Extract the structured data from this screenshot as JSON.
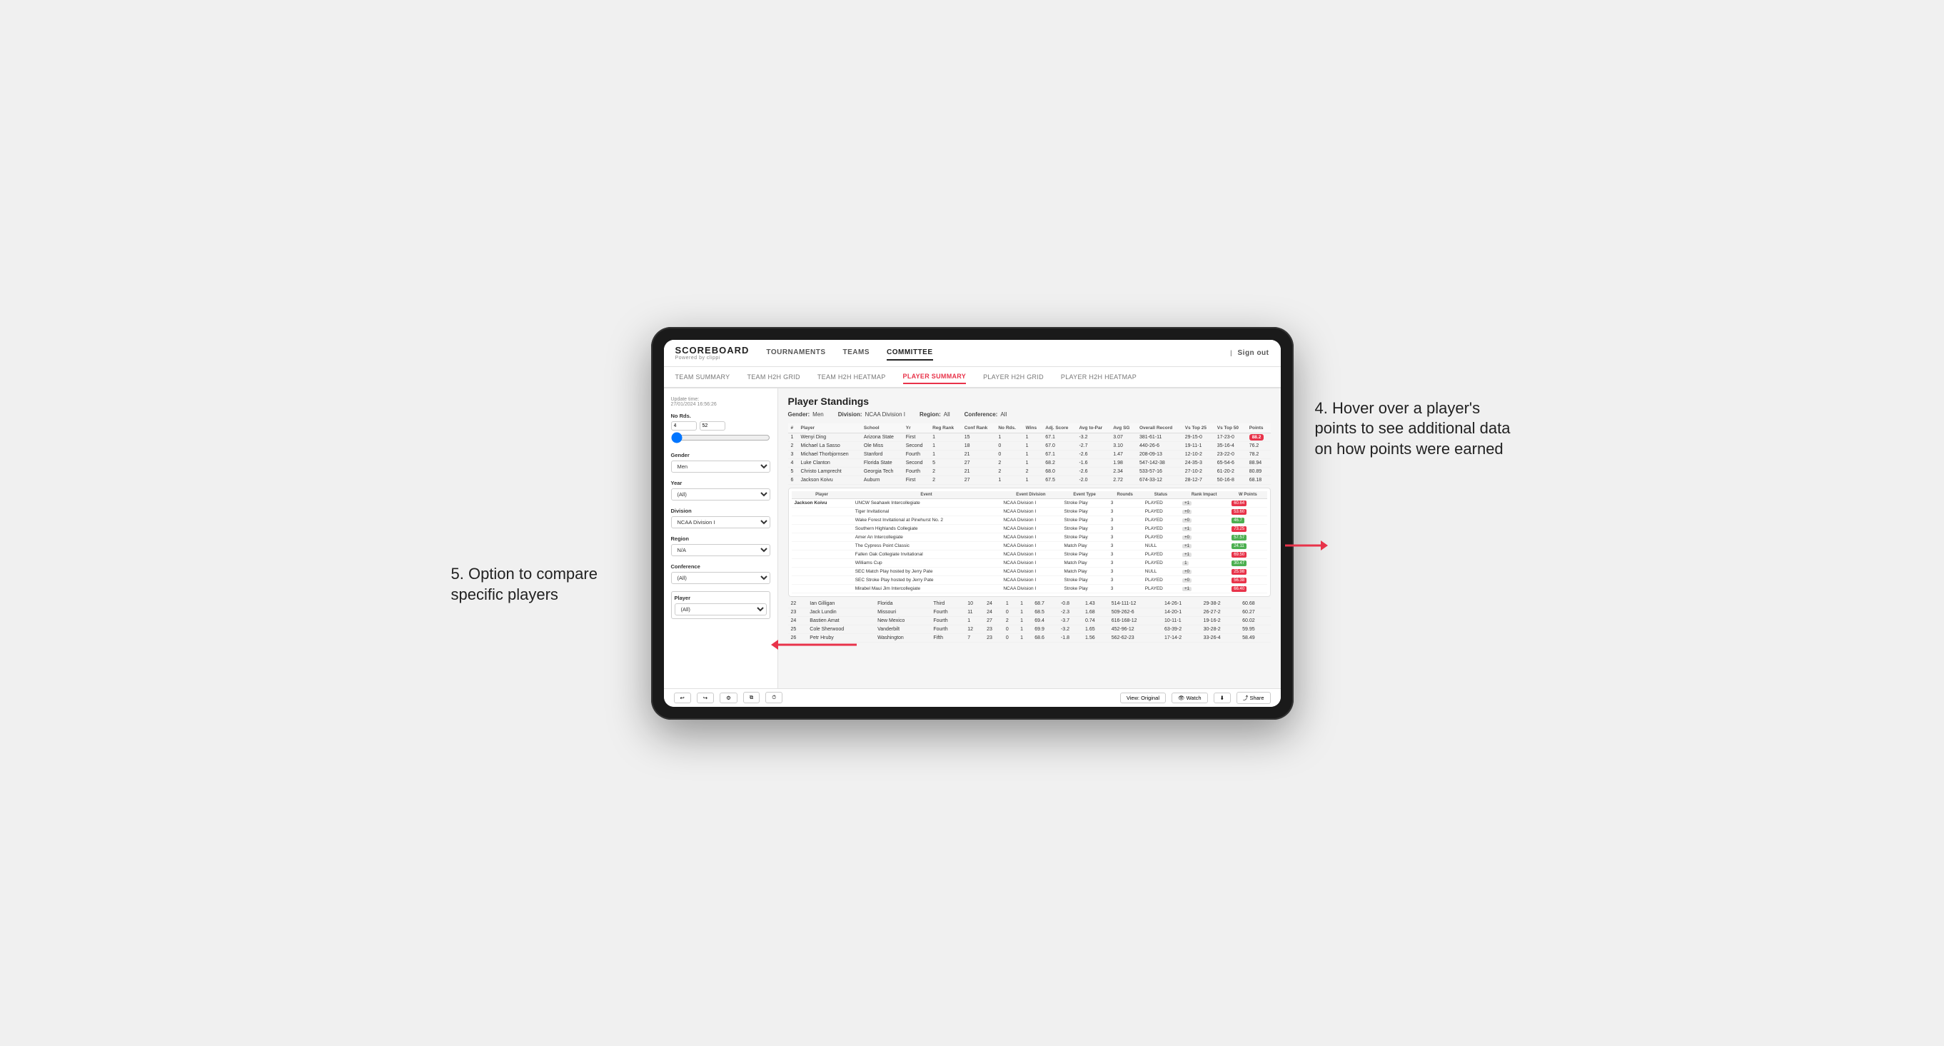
{
  "outer": {
    "annotation_right": "4. Hover over a player's points to see additional data on how points were earned",
    "annotation_left": "5. Option to compare specific players"
  },
  "header": {
    "logo": "SCOREBOARD",
    "logo_sub": "Powered by clippi",
    "nav_items": [
      "TOURNAMENTS",
      "TEAMS",
      "COMMITTEE"
    ],
    "active_nav": "COMMITTEE",
    "sign_out": "Sign out"
  },
  "sub_nav": {
    "items": [
      "TEAM SUMMARY",
      "TEAM H2H GRID",
      "TEAM H2H HEATMAP",
      "PLAYER SUMMARY",
      "PLAYER H2H GRID",
      "PLAYER H2H HEATMAP"
    ],
    "active": "PLAYER SUMMARY"
  },
  "sidebar": {
    "update_label": "Update time:",
    "update_time": "27/01/2024 16:56:26",
    "no_rds_label": "No Rds.",
    "no_rds_min": "4",
    "no_rds_max": "52",
    "gender_label": "Gender",
    "gender_value": "Men",
    "year_label": "Year",
    "year_value": "(All)",
    "division_label": "Division",
    "division_value": "NCAA Division I",
    "region_label": "Region",
    "region_value": "N/A",
    "conference_label": "Conference",
    "conference_value": "(All)",
    "player_label": "Player",
    "player_value": "(All)"
  },
  "content": {
    "title": "Player Standings",
    "gender_label": "Gender:",
    "gender_value": "Men",
    "division_label": "Division:",
    "division_value": "NCAA Division I",
    "region_label": "Region:",
    "region_value": "All",
    "conference_label": "Conference:",
    "conference_value": "All",
    "table_headers": [
      "#",
      "Player",
      "School",
      "Yr",
      "Reg Rank",
      "Conf Rank",
      "No Rds.",
      "Wins",
      "Adj. Score",
      "Avg to-Par",
      "Avg SG",
      "Overall Record",
      "Vs Top 25",
      "Vs Top 50",
      "Points"
    ],
    "players": [
      {
        "num": "1",
        "name": "Wenyi Ding",
        "school": "Arizona State",
        "yr": "First",
        "reg_rank": "1",
        "conf_rank": "15",
        "no_rds": "1",
        "wins": "1",
        "adj_score": "67.1",
        "to_par": "-3.2",
        "avg_sg": "3.07",
        "record": "381-61-11",
        "vs25": "29-15-0",
        "vs50": "17-23-0",
        "points": "88.2",
        "points_color": "red"
      },
      {
        "num": "2",
        "name": "Michael La Sasso",
        "school": "Ole Miss",
        "yr": "Second",
        "reg_rank": "1",
        "conf_rank": "18",
        "no_rds": "0",
        "wins": "1",
        "adj_score": "67.0",
        "to_par": "-2.7",
        "avg_sg": "3.10",
        "record": "440-26-6",
        "vs25": "19-11-1",
        "vs50": "35-16-4",
        "points": "76.2",
        "points_color": "normal"
      },
      {
        "num": "3",
        "name": "Michael Thorbjornsen",
        "school": "Stanford",
        "yr": "Fourth",
        "reg_rank": "1",
        "conf_rank": "21",
        "no_rds": "0",
        "wins": "1",
        "adj_score": "67.1",
        "to_par": "-2.6",
        "avg_sg": "1.47",
        "record": "208-09-13",
        "vs25": "12-10-2",
        "vs50": "23-22-0",
        "points": "78.2",
        "points_color": "normal"
      },
      {
        "num": "4",
        "name": "Luke Clanton",
        "school": "Florida State",
        "yr": "Second",
        "reg_rank": "5",
        "conf_rank": "27",
        "no_rds": "2",
        "wins": "1",
        "adj_score": "68.2",
        "to_par": "-1.6",
        "avg_sg": "1.98",
        "record": "547-142-38",
        "vs25": "24-35-3",
        "vs50": "65-54-6",
        "points": "88.94",
        "points_color": "normal"
      },
      {
        "num": "5",
        "name": "Christo Lamprecht",
        "school": "Georgia Tech",
        "yr": "Fourth",
        "reg_rank": "2",
        "conf_rank": "21",
        "no_rds": "2",
        "wins": "2",
        "adj_score": "68.0",
        "to_par": "-2.6",
        "avg_sg": "2.34",
        "record": "533-57-16",
        "vs25": "27-10-2",
        "vs50": "61-20-2",
        "points": "80.89",
        "points_color": "normal"
      },
      {
        "num": "6",
        "name": "Jackson Koivu",
        "school": "Auburn",
        "yr": "First",
        "reg_rank": "2",
        "conf_rank": "27",
        "no_rds": "1",
        "wins": "1",
        "adj_score": "67.5",
        "to_par": "-2.0",
        "avg_sg": "2.72",
        "record": "674-33-12",
        "vs25": "28-12-7",
        "vs50": "50-16-8",
        "points": "68.18",
        "points_color": "normal"
      }
    ],
    "event_section_player": "Jackson Koivu",
    "event_headers": [
      "Player",
      "Event",
      "Event Division",
      "Event Type",
      "Rounds",
      "Status",
      "Rank Impact",
      "W Points"
    ],
    "events": [
      {
        "player": "Jackson Koivu",
        "event": "UNCW Seahawk Intercollegiate",
        "division": "NCAA Division I",
        "type": "Stroke Play",
        "rounds": "3",
        "status": "PLAYED",
        "rank_impact": "+1",
        "w_points": "60.64",
        "badge": "red"
      },
      {
        "player": "",
        "event": "Tiger Invitational",
        "division": "NCAA Division I",
        "type": "Stroke Play",
        "rounds": "3",
        "status": "PLAYED",
        "rank_impact": "+0",
        "w_points": "53.60",
        "badge": "red"
      },
      {
        "player": "",
        "event": "Wake Forest Invitational at Pinehurst No. 2",
        "division": "NCAA Division I",
        "type": "Stroke Play",
        "rounds": "3",
        "status": "PLAYED",
        "rank_impact": "+0",
        "w_points": "46.7",
        "badge": "normal"
      },
      {
        "player": "",
        "event": "Southern Highlands Collegiate",
        "division": "NCAA Division I",
        "type": "Stroke Play",
        "rounds": "3",
        "status": "PLAYED",
        "rank_impact": "+1",
        "w_points": "73.25",
        "badge": "red"
      },
      {
        "player": "",
        "event": "Amer An Intercollegiate",
        "division": "NCAA Division I",
        "type": "Stroke Play",
        "rounds": "3",
        "status": "PLAYED",
        "rank_impact": "+0",
        "w_points": "57.57",
        "badge": "normal"
      },
      {
        "player": "",
        "event": "The Cypress Point Classic",
        "division": "NCAA Division I",
        "type": "Match Play",
        "rounds": "3",
        "status": "NULL",
        "rank_impact": "+1",
        "w_points": "24.11",
        "badge": "normal"
      },
      {
        "player": "",
        "event": "Fallen Oak Collegiate Invitational",
        "division": "NCAA Division I",
        "type": "Stroke Play",
        "rounds": "3",
        "status": "PLAYED",
        "rank_impact": "+1",
        "w_points": "69.50",
        "badge": "red"
      },
      {
        "player": "",
        "event": "Williams Cup",
        "division": "NCAA Division I",
        "type": "Match Play",
        "rounds": "3",
        "status": "PLAYED",
        "rank_impact": "1",
        "w_points": "30.47",
        "badge": "normal"
      },
      {
        "player": "",
        "event": "SEC Match Play hosted by Jerry Pate",
        "division": "NCAA Division I",
        "type": "Match Play",
        "rounds": "3",
        "status": "NULL",
        "rank_impact": "+0",
        "w_points": "25.98",
        "badge": "red"
      },
      {
        "player": "",
        "event": "SEC Stroke Play hosted by Jerry Pate",
        "division": "NCAA Division I",
        "type": "Stroke Play",
        "rounds": "3",
        "status": "PLAYED",
        "rank_impact": "+0",
        "w_points": "56.38",
        "badge": "red"
      },
      {
        "player": "",
        "event": "Mirabel Maui Jim Intercollegiate",
        "division": "NCAA Division I",
        "type": "Stroke Play",
        "rounds": "3",
        "status": "PLAYED",
        "rank_impact": "+1",
        "w_points": "66.40",
        "badge": "red"
      }
    ],
    "more_players": [
      {
        "num": "22",
        "name": "Ian Gilligan",
        "school": "Florida",
        "yr": "Third",
        "reg_rank": "10",
        "conf_rank": "24",
        "no_rds": "1",
        "wins": "1",
        "adj_score": "68.7",
        "to_par": "-0.8",
        "avg_sg": "1.43",
        "record": "514-111-12",
        "vs25": "14-26-1",
        "vs50": "29-38-2",
        "points": "60.68",
        "points_color": "normal"
      },
      {
        "num": "23",
        "name": "Jack Lundin",
        "school": "Missouri",
        "yr": "Fourth",
        "reg_rank": "11",
        "conf_rank": "24",
        "no_rds": "0",
        "wins": "1",
        "adj_score": "68.5",
        "to_par": "-2.3",
        "avg_sg": "1.68",
        "record": "509-262-6",
        "vs25": "14-20-1",
        "vs50": "26-27-2",
        "points": "60.27",
        "points_color": "normal"
      },
      {
        "num": "24",
        "name": "Bastien Amat",
        "school": "New Mexico",
        "yr": "Fourth",
        "reg_rank": "1",
        "conf_rank": "27",
        "no_rds": "2",
        "wins": "1",
        "adj_score": "69.4",
        "to_par": "-3.7",
        "avg_sg": "0.74",
        "record": "616-168-12",
        "vs25": "10-11-1",
        "vs50": "19-16-2",
        "points": "60.02",
        "points_color": "normal"
      },
      {
        "num": "25",
        "name": "Cole Sherwood",
        "school": "Vanderbilt",
        "yr": "Fourth",
        "reg_rank": "12",
        "conf_rank": "23",
        "no_rds": "0",
        "wins": "1",
        "adj_score": "69.9",
        "to_par": "-3.2",
        "avg_sg": "1.65",
        "record": "452-96-12",
        "vs25": "63-39-2",
        "vs50": "30-28-2",
        "points": "59.95",
        "points_color": "normal"
      },
      {
        "num": "26",
        "name": "Petr Hruby",
        "school": "Washington",
        "yr": "Fifth",
        "reg_rank": "7",
        "conf_rank": "23",
        "no_rds": "0",
        "wins": "1",
        "adj_score": "68.6",
        "to_par": "-1.8",
        "avg_sg": "1.56",
        "record": "562-62-23",
        "vs25": "17-14-2",
        "vs50": "33-26-4",
        "points": "58.49",
        "points_color": "normal"
      }
    ]
  },
  "toolbar": {
    "undo": "↩",
    "redo": "↪",
    "settings": "⚙",
    "copy": "⧉",
    "view_label": "View: Original",
    "watch_label": "Watch",
    "download": "⬇",
    "share_label": "Share"
  }
}
